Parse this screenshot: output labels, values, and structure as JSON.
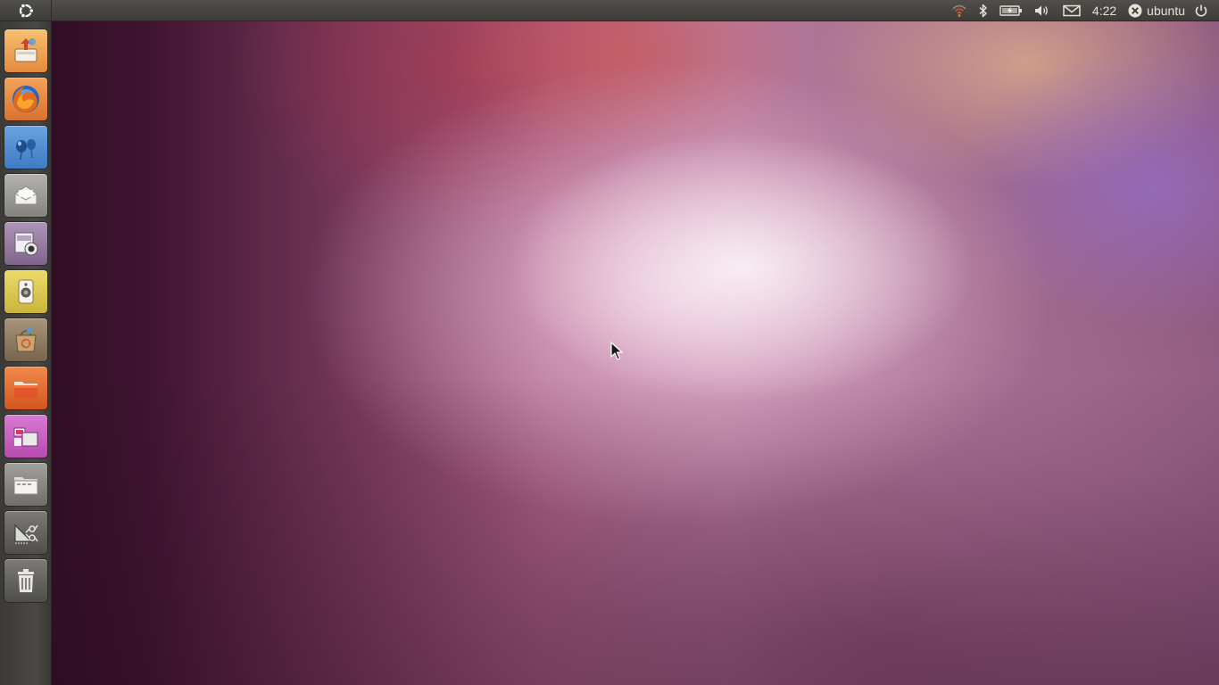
{
  "top_panel": {
    "bfb_icon": "ubuntu-logo-icon",
    "indicators": {
      "network_icon": "wifi-icon",
      "bluetooth_icon": "bluetooth-icon",
      "battery_icon": "battery-icon",
      "sound_icon": "volume-icon",
      "messaging_icon": "envelope-icon",
      "clock": "4:22",
      "user_icon": "user-status-icon",
      "user_name": "ubuntu",
      "session_icon": "power-icon"
    }
  },
  "launcher": {
    "items": [
      {
        "icon": "installer-icon",
        "color": "#f2a75a"
      },
      {
        "icon": "firefox-icon",
        "color": "#e9853a"
      },
      {
        "icon": "empathy-icon",
        "color": "#4a88d0"
      },
      {
        "icon": "mail-icon",
        "color": "#9a9a96"
      },
      {
        "icon": "webcam-icon",
        "color": "#9b7ea6"
      },
      {
        "icon": "speaker-icon",
        "color": "#d8c64a"
      },
      {
        "icon": "software-center-icon",
        "color": "#8c7a62"
      },
      {
        "icon": "home-folder-icon",
        "color": "#e36a2e"
      },
      {
        "icon": "workspace-switcher-icon",
        "color": "#c866c2"
      },
      {
        "icon": "applications-icon",
        "color": "#85847f"
      },
      {
        "icon": "files-tools-icon",
        "color": "#6b6a66"
      },
      {
        "icon": "trash-icon",
        "color": "#6b6a66"
      }
    ]
  }
}
